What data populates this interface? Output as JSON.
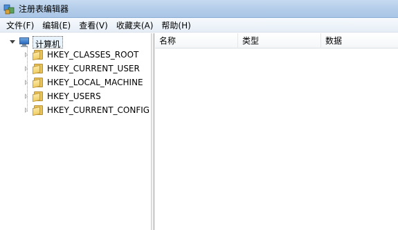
{
  "window": {
    "title": "注册表编辑器"
  },
  "menu": [
    "文件(F)",
    "编辑(E)",
    "查看(V)",
    "收藏夹(A)",
    "帮助(H)"
  ],
  "tree": {
    "root": "计算机",
    "keys": [
      "HKEY_CLASSES_ROOT",
      "HKEY_CURRENT_USER",
      "HKEY_LOCAL_MACHINE",
      "HKEY_USERS",
      "HKEY_CURRENT_CONFIG"
    ]
  },
  "list": {
    "columns": [
      "名称",
      "类型",
      "数据"
    ]
  },
  "icons": {
    "app": "registry-editor-icon",
    "root": "computer-icon",
    "key": "folder-icon"
  }
}
